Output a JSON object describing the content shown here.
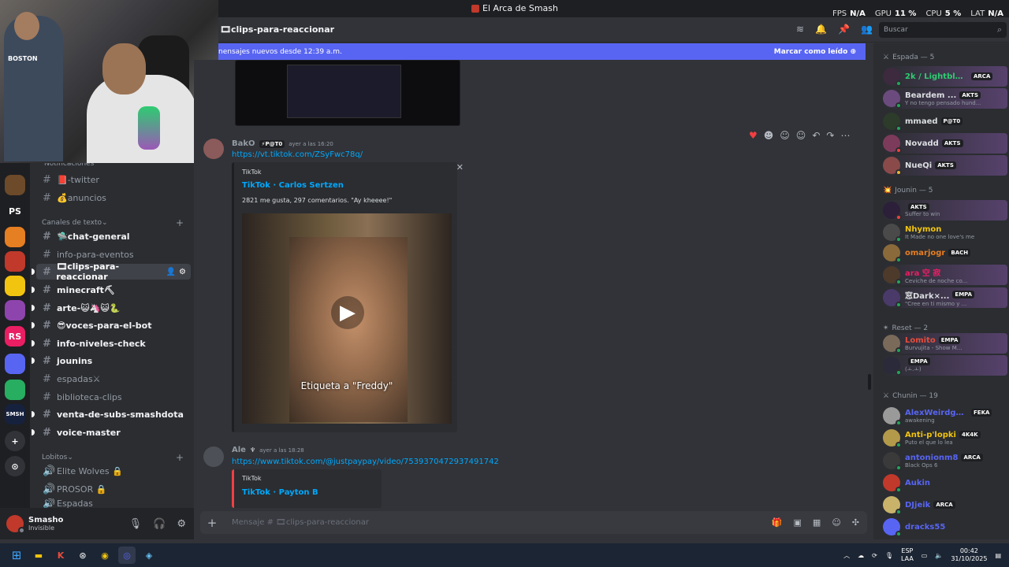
{
  "window": {
    "title": "El Arca de Smash"
  },
  "stats": [
    {
      "label": "FPS",
      "value": "N/A"
    },
    {
      "label": "GPU",
      "value": "11 %"
    },
    {
      "label": "CPU",
      "value": "5 %"
    },
    {
      "label": "LAT",
      "value": "N/A"
    }
  ],
  "webcam": {
    "shirt_text": "BOSTON"
  },
  "guilds": [
    {
      "label": "",
      "color": "#6d4a2a"
    },
    {
      "label": "PS",
      "color": "#1e1f22"
    },
    {
      "label": "",
      "color": "#e67e22"
    },
    {
      "label": "",
      "color": "#c0392b"
    },
    {
      "label": "",
      "color": "#f1c40f"
    },
    {
      "label": "",
      "color": "#8e44ad"
    },
    {
      "label": "RS",
      "color": "#e91e63"
    },
    {
      "label": "",
      "color": "#5865f2"
    },
    {
      "label": "",
      "color": "#27ae60"
    },
    {
      "label": "SMSH",
      "color": "#16213e"
    },
    {
      "label": "+",
      "color": "#313338"
    },
    {
      "label": "⊙",
      "color": "#313338"
    }
  ],
  "channels": {
    "partial_top": "Notificaciones",
    "items_a": [
      {
        "name": "📕-twitter",
        "unread": false
      },
      {
        "name": "💰anuncios",
        "unread": false
      }
    ],
    "cat_text": "Canales de texto",
    "items_b": [
      {
        "name": "🛸chat-general",
        "unread": true
      },
      {
        "name": "info-para-eventos",
        "unread": false
      },
      {
        "name": "🎞clips-para-reaccionar",
        "unread": true,
        "active": true
      },
      {
        "name": "minecraft⛏",
        "unread": true
      },
      {
        "name": "arte-😺🦄😺🐍",
        "unread": true
      },
      {
        "name": "😎voces-para-el-bot",
        "unread": true
      },
      {
        "name": "info-niveles-check",
        "unread": true
      },
      {
        "name": "jounins",
        "unread": true
      },
      {
        "name": "espadas⚔",
        "unread": false
      },
      {
        "name": "biblioteca-clips",
        "unread": false
      },
      {
        "name": "venta-de-subs-smashdota",
        "unread": true
      },
      {
        "name": "voice-master",
        "unread": true
      }
    ],
    "cat_lobitos": "Lobitos",
    "voice": [
      {
        "name": "Elite Wolves 🔒"
      },
      {
        "name": "PROSOR 🔒"
      },
      {
        "name": "Espadas"
      }
    ]
  },
  "user": {
    "name": "Smasho",
    "status": "Invisible"
  },
  "chat_header": {
    "channel": "🎞clips-para-reaccionar"
  },
  "search": {
    "placeholder": "Buscar"
  },
  "banner": {
    "text": "nensajes nuevos desde 12:39 a.m.",
    "action": "Marcar como leído"
  },
  "message1": {
    "author": "BakO",
    "tag": "⚡P@T0",
    "time": "ayer a las 16:20",
    "link": "https://vt.tiktok.com/ZSyFwc78q/",
    "embed": {
      "provider": "TikTok",
      "title": "TikTok · Carlos Sertzen",
      "desc": "2821 me gusta, 297 comentarios. \"Ay kheeee!\"",
      "caption": "Etiqueta a \"Freddy\""
    }
  },
  "message2": {
    "author": "Ale",
    "time": "ayer a las 18:28",
    "link": "https://www.tiktok.com/@justpaypay/video/7539370472937491742",
    "embed": {
      "provider": "TikTok",
      "title": "TikTok · Payton B"
    }
  },
  "composer": {
    "placeholder": "Mensaje # 🎞clips-para-reaccionar"
  },
  "members": {
    "groups": [
      {
        "title": "Espada — 5",
        "icon": "⚔"
      },
      {
        "title": "Jounin — 5",
        "icon": "💥"
      },
      {
        "title": "Reset — 2",
        "icon": "✴"
      },
      {
        "title": "Chunin — 19",
        "icon": "⚔"
      }
    ],
    "list": [
      {
        "name": "2k / Lightblu...",
        "tag": "ARCA",
        "activity": "",
        "color": "#2ecc71",
        "boost": true
      },
      {
        "name": "Beardem ...",
        "tag": "AKTS",
        "activity": "Y no tengo pensado hund...",
        "color": "#dbdee1",
        "boost": true
      },
      {
        "name": "mmaed",
        "tag": "P@T0",
        "activity": "",
        "color": "#dbdee1",
        "boost": false
      },
      {
        "name": "Novadd",
        "tag": "AKTS",
        "activity": "",
        "color": "#dbdee1",
        "boost": true
      },
      {
        "name": "NueQi",
        "tag": "AKTS",
        "activity": "",
        "color": "#dbdee1",
        "boost": true
      },
      {
        "name": "",
        "tag": "AKTS",
        "activity": "Suffer to win",
        "color": "#dbdee1",
        "boost": true
      },
      {
        "name": "Nhymon",
        "tag": "",
        "activity": "It Made no one love's me",
        "color": "#f1c40f",
        "boost": false
      },
      {
        "name": "omarjogr",
        "tag": "BACH",
        "activity": "",
        "color": "#e67e22",
        "boost": false
      },
      {
        "name": "ara 空 寂",
        "tag": "",
        "activity": "Ceviche de noche co...",
        "color": "#e91e63",
        "boost": true
      },
      {
        "name": "窓Dark×...",
        "tag": "EMPA",
        "activity": "\"Cree en ti mismo y ...",
        "color": "#dbdee1",
        "boost": true
      },
      {
        "name": "Lomito",
        "tag": "EMPA",
        "activity": "Burvujita - Show M...",
        "color": "#e74c3c",
        "boost": true
      },
      {
        "name": "",
        "tag": "EMPA",
        "activity": "(ㅗ.ㅗ)",
        "color": "#e74c3c",
        "boost": true
      },
      {
        "name": "AlexWeirdge ...",
        "tag": "FEKA",
        "activity": "awakening",
        "color": "#5865f2",
        "boost": false
      },
      {
        "name": "Anti-p'lopki",
        "tag": "4K4K",
        "activity": "Puto el que lo lea",
        "color": "#f1c40f",
        "boost": false
      },
      {
        "name": "antonionm8",
        "tag": "ARCA",
        "activity": "Black Ops 6",
        "color": "#5865f2",
        "boost": false
      },
      {
        "name": "Aukin",
        "tag": "",
        "activity": "",
        "color": "#5865f2",
        "boost": false
      },
      {
        "name": "DJjeik",
        "tag": "ARCA",
        "activity": "",
        "color": "#5865f2",
        "boost": false
      },
      {
        "name": "dracks55",
        "tag": "",
        "activity": "",
        "color": "#5865f2",
        "boost": false
      }
    ]
  },
  "taskbar": {
    "lang": "ESP",
    "lang2": "LAA",
    "time": "00:42",
    "date": "31/10/2025"
  }
}
